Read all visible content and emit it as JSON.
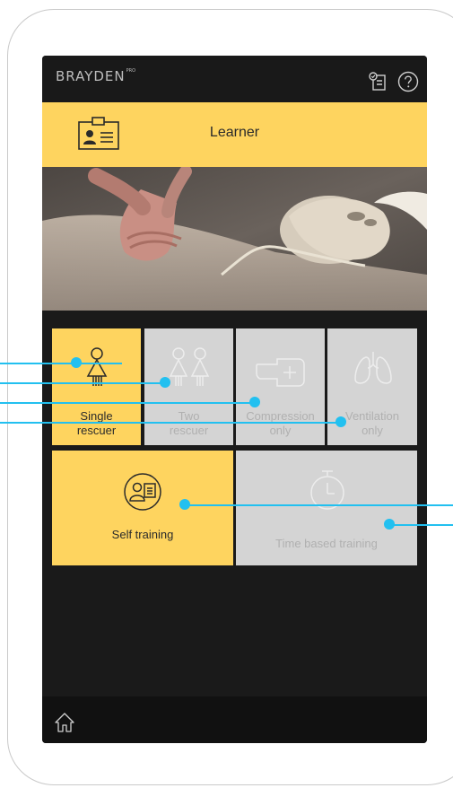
{
  "app": {
    "brand": "BRAYDEN",
    "brand_suffix": "PRO"
  },
  "header": {
    "title": "Learner",
    "icon": "id-card-icon"
  },
  "topbar": {
    "icons": [
      "checklist-icon",
      "help-icon"
    ]
  },
  "mode_tiles": [
    {
      "label_line1": "Single",
      "label_line2": "rescuer",
      "icon": "single-person-icon",
      "state": "selected"
    },
    {
      "label_line1": "Two",
      "label_line2": "rescuer",
      "icon": "two-persons-icon",
      "state": "disabled"
    },
    {
      "label_line1": "Compression",
      "label_line2": "only",
      "icon": "hand-compression-icon",
      "state": "disabled"
    },
    {
      "label_line1": "Ventilation",
      "label_line2": "only",
      "icon": "lungs-icon",
      "state": "disabled"
    }
  ],
  "training_tiles": [
    {
      "label": "Self training",
      "icon": "self-training-icon",
      "state": "selected"
    },
    {
      "label": "Time based training",
      "icon": "stopwatch-icon",
      "state": "disabled"
    }
  ],
  "footer": {
    "icon": "home-icon"
  },
  "colors": {
    "accent": "#fed45f",
    "disabled_tile": "#d4d4d4",
    "callout": "#22c0f0",
    "screen_bg": "#1a1a1a"
  }
}
